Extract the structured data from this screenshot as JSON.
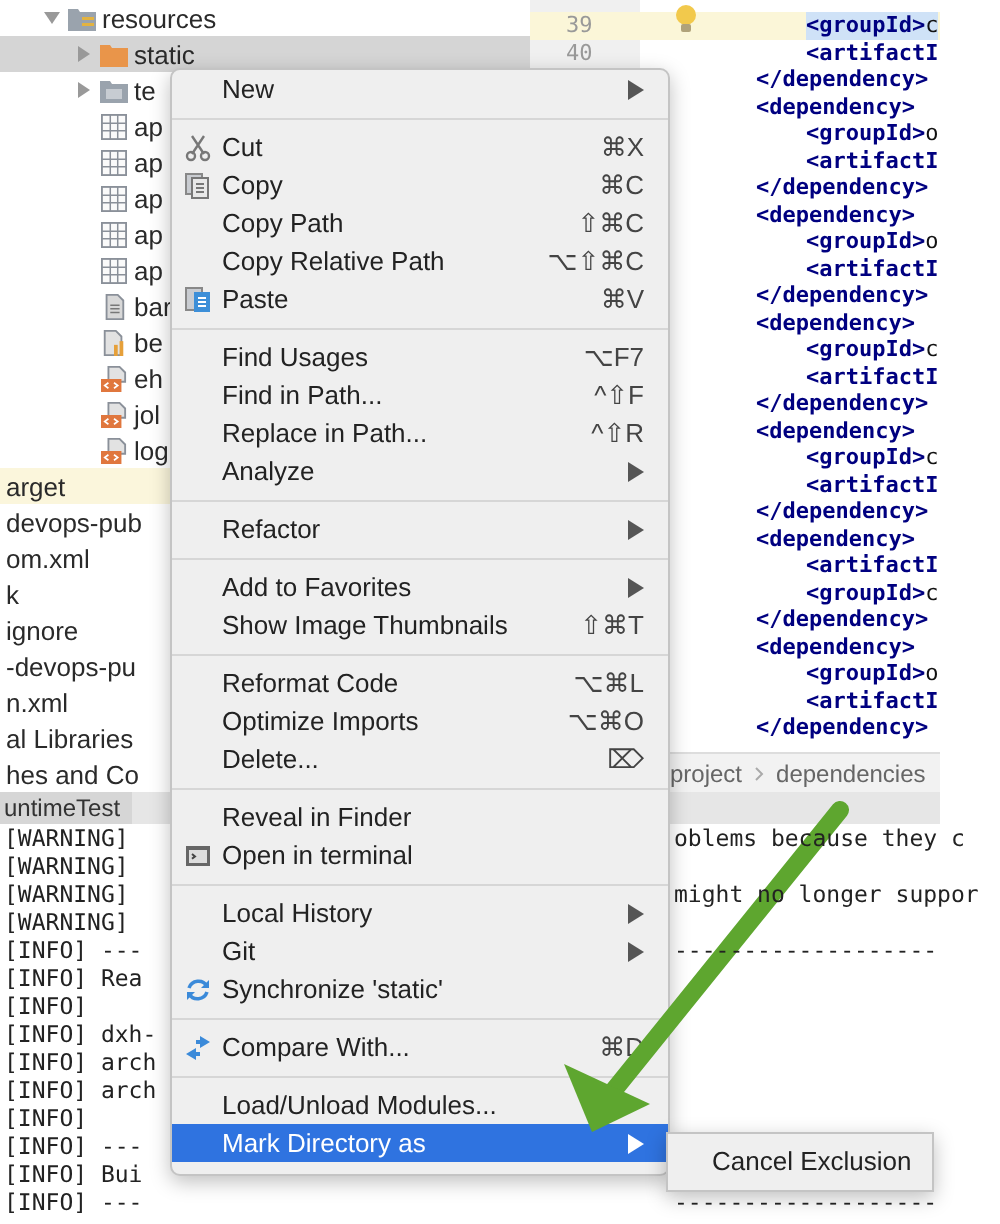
{
  "project_tree": [
    {
      "label": "resources",
      "kind": "resources-folder",
      "expanded": true,
      "selected": false,
      "excluded": false,
      "children": [
        {
          "label": "static",
          "kind": "web-folder",
          "expanded": false,
          "selected": true,
          "excluded": false
        },
        {
          "label": "te",
          "kind": "folder",
          "expanded": false,
          "selected": false,
          "excluded": false
        },
        {
          "label": "ap",
          "kind": "table",
          "selected": false,
          "excluded": false
        },
        {
          "label": "ap",
          "kind": "table",
          "selected": false,
          "excluded": false
        },
        {
          "label": "ap",
          "kind": "table",
          "selected": false,
          "excluded": false
        },
        {
          "label": "ap",
          "kind": "table",
          "selected": false,
          "excluded": false
        },
        {
          "label": "ap",
          "kind": "table",
          "selected": false,
          "excluded": false
        },
        {
          "label": "bar",
          "kind": "file",
          "selected": false,
          "excluded": false
        },
        {
          "label": "be",
          "kind": "chart-file",
          "selected": false,
          "excluded": false
        },
        {
          "label": "eh",
          "kind": "xml",
          "selected": false,
          "excluded": false
        },
        {
          "label": "jol",
          "kind": "xml",
          "selected": false,
          "excluded": false
        },
        {
          "label": "log",
          "kind": "xml",
          "selected": false,
          "excluded": false
        }
      ]
    },
    {
      "label": "arget",
      "kind": "entry",
      "selected": false,
      "excluded": true
    },
    {
      "label": "devops-pub",
      "kind": "entry",
      "selected": false,
      "excluded": false
    },
    {
      "label": "om.xml",
      "kind": "entry",
      "selected": false,
      "excluded": false
    },
    {
      "label": "k",
      "kind": "entry",
      "selected": false,
      "excluded": false
    },
    {
      "label": "ignore",
      "kind": "entry",
      "selected": false,
      "excluded": false
    },
    {
      "label": "-devops-pu",
      "kind": "entry",
      "selected": false,
      "excluded": false
    },
    {
      "label": "n.xml",
      "kind": "entry",
      "selected": false,
      "excluded": false
    },
    {
      "label": "al Libraries",
      "kind": "entry",
      "selected": false,
      "excluded": false
    },
    {
      "label": "hes and Co",
      "kind": "entry",
      "selected": false,
      "excluded": false
    }
  ],
  "editor": {
    "line_numbers": [
      {
        "text": "39",
        "current": true
      },
      {
        "text": "40",
        "current": false
      }
    ],
    "code": [
      {
        "lines": [
          {
            "tag": "<groupId>",
            "value": "c",
            "highlighted": true
          },
          {
            "tag": "<artifactI",
            "highlighted": false
          }
        ],
        "close": "</dependency>"
      },
      {
        "open": "<dependency>",
        "lines": [
          {
            "tag": "<groupId>",
            "value": "o",
            "highlighted": false
          },
          {
            "tag": "<artifactI",
            "highlighted": false
          }
        ],
        "close": "</dependency>"
      },
      {
        "open": "<dependency>",
        "lines": [
          {
            "tag": "<groupId>",
            "value": "o",
            "highlighted": false
          },
          {
            "tag": "<artifactI",
            "highlighted": false
          }
        ],
        "close": "</dependency>"
      },
      {
        "open": "<dependency>",
        "lines": [
          {
            "tag": "<groupId>",
            "value": "c",
            "highlighted": false
          },
          {
            "tag": "<artifactI",
            "highlighted": false
          }
        ],
        "close": "</dependency>"
      },
      {
        "open": "<dependency>",
        "lines": [
          {
            "tag": "<groupId>",
            "value": "c",
            "highlighted": false
          },
          {
            "tag": "<artifactI",
            "highlighted": false
          }
        ],
        "close": "</dependency>"
      },
      {
        "open": "<dependency>",
        "lines": [
          {
            "tag": "<artifactI",
            "highlighted": false
          },
          {
            "tag": "<groupId>",
            "value": "c",
            "highlighted": false
          }
        ],
        "close": "</dependency>"
      },
      {
        "open": "<dependency>",
        "lines": [
          {
            "tag": "<groupId>",
            "value": "o",
            "highlighted": false
          },
          {
            "tag": "<artifactI",
            "highlighted": false
          }
        ],
        "close": "</dependency>"
      }
    ],
    "breadcrumbs": [
      "project",
      "dependencies"
    ]
  },
  "run_panel": {
    "tab": "untimeTest",
    "lines": [
      {
        "left": "[WARNING]",
        "right": "oblems because they c"
      },
      {
        "left": "[WARNING]"
      },
      {
        "left": "[WARNING]",
        "right": "might no longer suppor"
      },
      {
        "left": "[WARNING]"
      },
      {
        "left": "[INFO] ---",
        "right": "-------------------"
      },
      {
        "left": "[INFO] Rea"
      },
      {
        "left": "[INFO]"
      },
      {
        "left": "[INFO] dxh-"
      },
      {
        "left": "[INFO] arch"
      },
      {
        "left": "[INFO] arch"
      },
      {
        "left": "[INFO]"
      },
      {
        "left": "[INFO] ---"
      },
      {
        "left": "[INFO] Bui"
      },
      {
        "left": "[INFO] ---",
        "right": "-------------------"
      }
    ]
  },
  "context_menu": {
    "sections": [
      {
        "items": [
          {
            "label": "New",
            "kind": "plain",
            "submenu": true,
            "selected": false
          }
        ]
      },
      {
        "items": [
          {
            "label": "Cut",
            "kind": "scissors",
            "shortcut": "⌘X",
            "submenu": false,
            "selected": false
          },
          {
            "label": "Copy",
            "kind": "copy",
            "shortcut": "⌘C",
            "submenu": false,
            "selected": false
          },
          {
            "label": "Copy Path",
            "kind": "plain",
            "shortcut": "⇧⌘C",
            "submenu": false,
            "selected": false
          },
          {
            "label": "Copy Relative Path",
            "kind": "plain",
            "shortcut": "⌥⇧⌘C",
            "submenu": false,
            "selected": false
          },
          {
            "label": "Paste",
            "kind": "paste",
            "shortcut": "⌘V",
            "submenu": false,
            "selected": false
          }
        ]
      },
      {
        "items": [
          {
            "label": "Find Usages",
            "kind": "plain",
            "shortcut": "⌥F7",
            "submenu": false,
            "selected": false
          },
          {
            "label": "Find in Path...",
            "kind": "plain",
            "shortcut": "^⇧F",
            "submenu": false,
            "selected": false
          },
          {
            "label": "Replace in Path...",
            "kind": "plain",
            "shortcut": "^⇧R",
            "submenu": false,
            "selected": false
          },
          {
            "label": "Analyze",
            "kind": "plain",
            "submenu": true,
            "selected": false
          }
        ]
      },
      {
        "items": [
          {
            "label": "Refactor",
            "kind": "plain",
            "submenu": true,
            "selected": false
          }
        ]
      },
      {
        "items": [
          {
            "label": "Add to Favorites",
            "kind": "plain",
            "submenu": true,
            "selected": false
          },
          {
            "label": "Show Image Thumbnails",
            "kind": "plain",
            "shortcut": "⇧⌘T",
            "submenu": false,
            "selected": false
          }
        ]
      },
      {
        "items": [
          {
            "label": "Reformat Code",
            "kind": "plain",
            "shortcut": "⌥⌘L",
            "submenu": false,
            "selected": false
          },
          {
            "label": "Optimize Imports",
            "kind": "plain",
            "shortcut": "⌥⌘O",
            "submenu": false,
            "selected": false
          },
          {
            "label": "Delete...",
            "kind": "plain",
            "shortcut": "⌦",
            "submenu": false,
            "selected": false
          }
        ]
      },
      {
        "items": [
          {
            "label": "Reveal in Finder",
            "kind": "plain",
            "submenu": false,
            "selected": false
          },
          {
            "label": "Open in terminal",
            "kind": "terminal",
            "submenu": false,
            "selected": false
          }
        ]
      },
      {
        "items": [
          {
            "label": "Local History",
            "kind": "plain",
            "submenu": true,
            "selected": false
          },
          {
            "label": "Git",
            "kind": "plain",
            "submenu": true,
            "selected": false
          },
          {
            "label": "Synchronize 'static'",
            "kind": "sync",
            "submenu": false,
            "selected": false
          }
        ]
      },
      {
        "items": [
          {
            "label": "Compare With...",
            "kind": "compare",
            "shortcut": "⌘D",
            "submenu": false,
            "selected": false
          }
        ]
      },
      {
        "items": [
          {
            "label": "Load/Unload Modules...",
            "kind": "plain",
            "submenu": false,
            "selected": false
          },
          {
            "label": "Mark Directory as",
            "kind": "plain",
            "submenu": true,
            "selected": true
          }
        ]
      }
    ]
  },
  "submenu": {
    "items": [
      {
        "label": "Cancel Exclusion",
        "selected": false
      }
    ]
  }
}
